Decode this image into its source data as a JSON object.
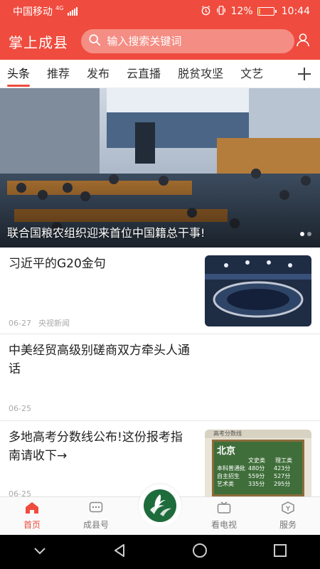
{
  "status_bar": {
    "carrier": "中国移动",
    "network": "4G",
    "battery": "12%",
    "battery_level": 0.12,
    "time": "10:44"
  },
  "header": {
    "app_title": "掌上成县",
    "search_placeholder": "输入搜索关键词"
  },
  "tabs": [
    {
      "label": "头条",
      "active": true
    },
    {
      "label": "推荐"
    },
    {
      "label": "发布"
    },
    {
      "label": "云直播"
    },
    {
      "label": "脱贫攻坚"
    },
    {
      "label": "文艺"
    }
  ],
  "banner": {
    "caption": "联合国粮农组织迎来首位中国籍总干事!",
    "slide_count": 2,
    "active_slide": 1
  },
  "news": [
    {
      "title": "习近平的G20金句",
      "date": "06-27",
      "source": "央视新闻"
    },
    {
      "title_lines": [
        "中美经贸高级别磋商双方牵头人通",
        "话"
      ],
      "date": "06-25"
    },
    {
      "title_lines": [
        "多地高考分数线公布!这份报考指",
        "南请收下→"
      ],
      "date": "06-25",
      "thumb_text": {
        "heading": "北京",
        "caption": "高考分数线",
        "columns": [
          "文史类",
          "理工类"
        ],
        "rows": [
          {
            "label": "本科普通批",
            "values": [
              "480分",
              "423分"
            ]
          },
          {
            "label": "自主招生",
            "values": [
              "559分",
              "527分"
            ]
          },
          {
            "label": "艺术类",
            "values": [
              "335分",
              "295分"
            ]
          }
        ]
      }
    }
  ],
  "bottom_nav": [
    {
      "label": "首页",
      "icon": "home-icon",
      "active": true
    },
    {
      "label": "成县号",
      "icon": "chat-icon"
    },
    {
      "label": "",
      "icon": "app-logo-icon"
    },
    {
      "label": "看电视",
      "icon": "tv-icon"
    },
    {
      "label": "服务",
      "icon": "service-icon"
    }
  ],
  "colors": {
    "brand": "#ef4b3e",
    "search_bg": "#f48d84",
    "chalkboard": "#3f6e3a"
  }
}
